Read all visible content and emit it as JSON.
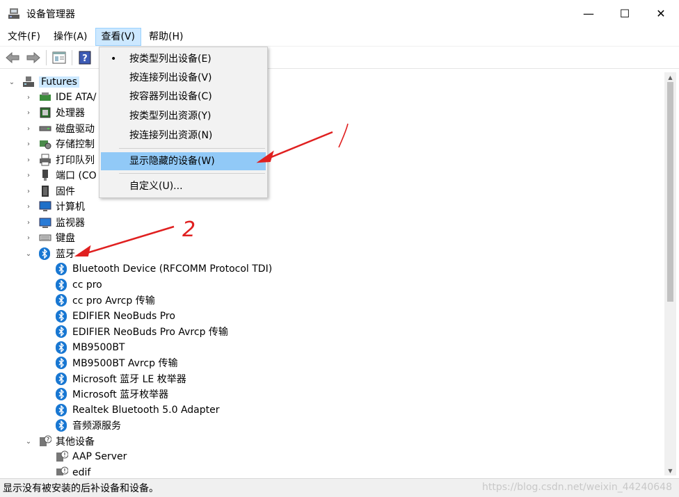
{
  "window": {
    "title": "设备管理器",
    "minimize": "—",
    "maximize": "☐",
    "close": "✕"
  },
  "menubar": {
    "file": "文件(F)",
    "action": "操作(A)",
    "view": "查看(V)",
    "help": "帮助(H)"
  },
  "view_menu": {
    "by_type": "按类型列出设备(E)",
    "by_connection": "按连接列出设备(V)",
    "by_container": "按容器列出设备(C)",
    "res_by_type": "按类型列出资源(Y)",
    "res_by_connection": "按连接列出资源(N)",
    "show_hidden": "显示隐藏的设备(W)",
    "customize": "自定义(U)...",
    "bullet": "•"
  },
  "tree": {
    "root": "Futures",
    "categories": {
      "ide": "IDE ATA/",
      "processor": "处理器",
      "disk": "磁盘驱动",
      "storage": "存储控制",
      "print": "打印队列",
      "ports": "端口 (CO",
      "firmware": "固件",
      "computer": "计算机",
      "monitor": "监视器",
      "keyboard": "键盘",
      "bluetooth": "蓝牙",
      "other": "其他设备"
    },
    "bluetooth_devices": [
      "Bluetooth Device (RFCOMM Protocol TDI)",
      "cc pro",
      "cc pro Avrcp 传输",
      "EDIFIER NeoBuds Pro",
      "EDIFIER NeoBuds Pro Avrcp 传输",
      "MB9500BT",
      "MB9500BT Avrcp 传输",
      "Microsoft 蓝牙 LE 枚举器",
      "Microsoft 蓝牙枚举器",
      "Realtek Bluetooth 5.0 Adapter",
      "音频源服务"
    ],
    "other_devices": [
      "AAP Server",
      "edif"
    ]
  },
  "statusbar": {
    "text": "显示没有被安装的后补设备和设备。"
  },
  "watermark": "https://blog.csdn.net/weixin_44240648",
  "annotations": {
    "label_1": "1",
    "label_2": "2"
  },
  "colors": {
    "highlight": "#91c9f7",
    "selected": "#cce8ff",
    "bluetooth": "#1877d2",
    "arrow": "#e02020"
  }
}
